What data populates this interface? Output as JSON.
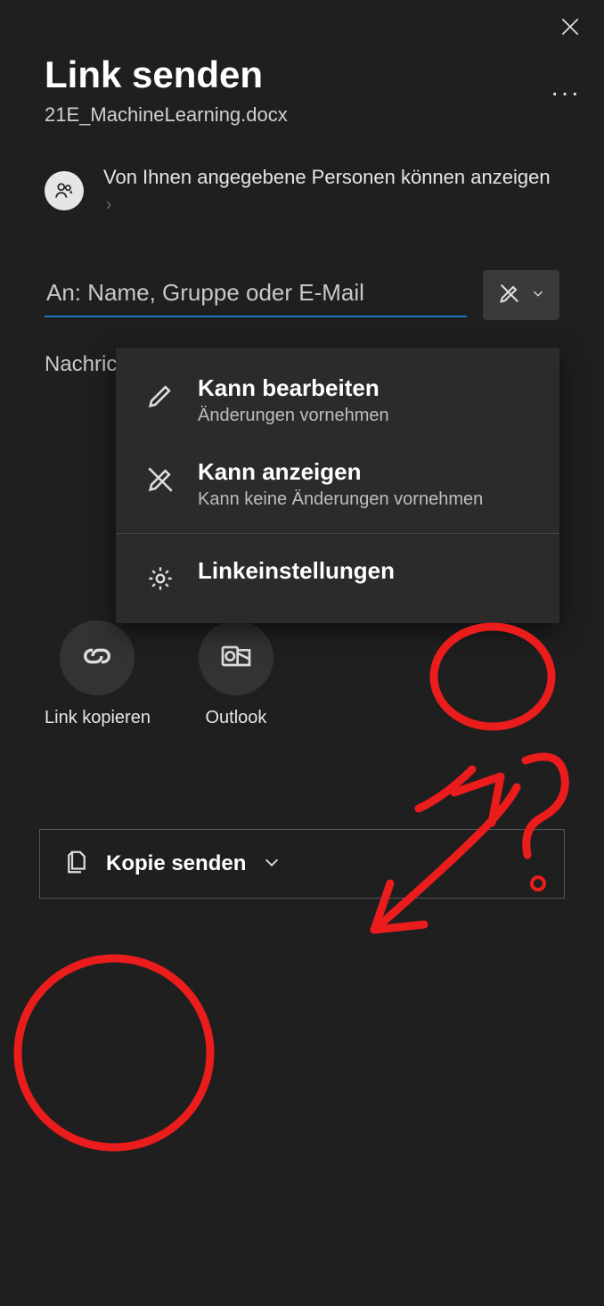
{
  "header": {
    "title": "Link senden",
    "filename": "21E_MachineLearning.docx"
  },
  "scope": {
    "text": "Von Ihnen angegebene Personen können anzeigen"
  },
  "recipient": {
    "placeholder": "An: Name, Gruppe oder E-Mail"
  },
  "message": {
    "label": "Nachricht.."
  },
  "permission_menu": {
    "edit": {
      "title": "Kann bearbeiten",
      "subtitle": "Änderungen vornehmen"
    },
    "view": {
      "title": "Kann anzeigen",
      "subtitle": "Kann keine Änderungen vornehmen"
    },
    "settings": {
      "title": "Linkeinstellungen"
    }
  },
  "actions": {
    "copy_link": "Link kopieren",
    "outlook": "Outlook"
  },
  "footer": {
    "label": "Kopie senden"
  }
}
